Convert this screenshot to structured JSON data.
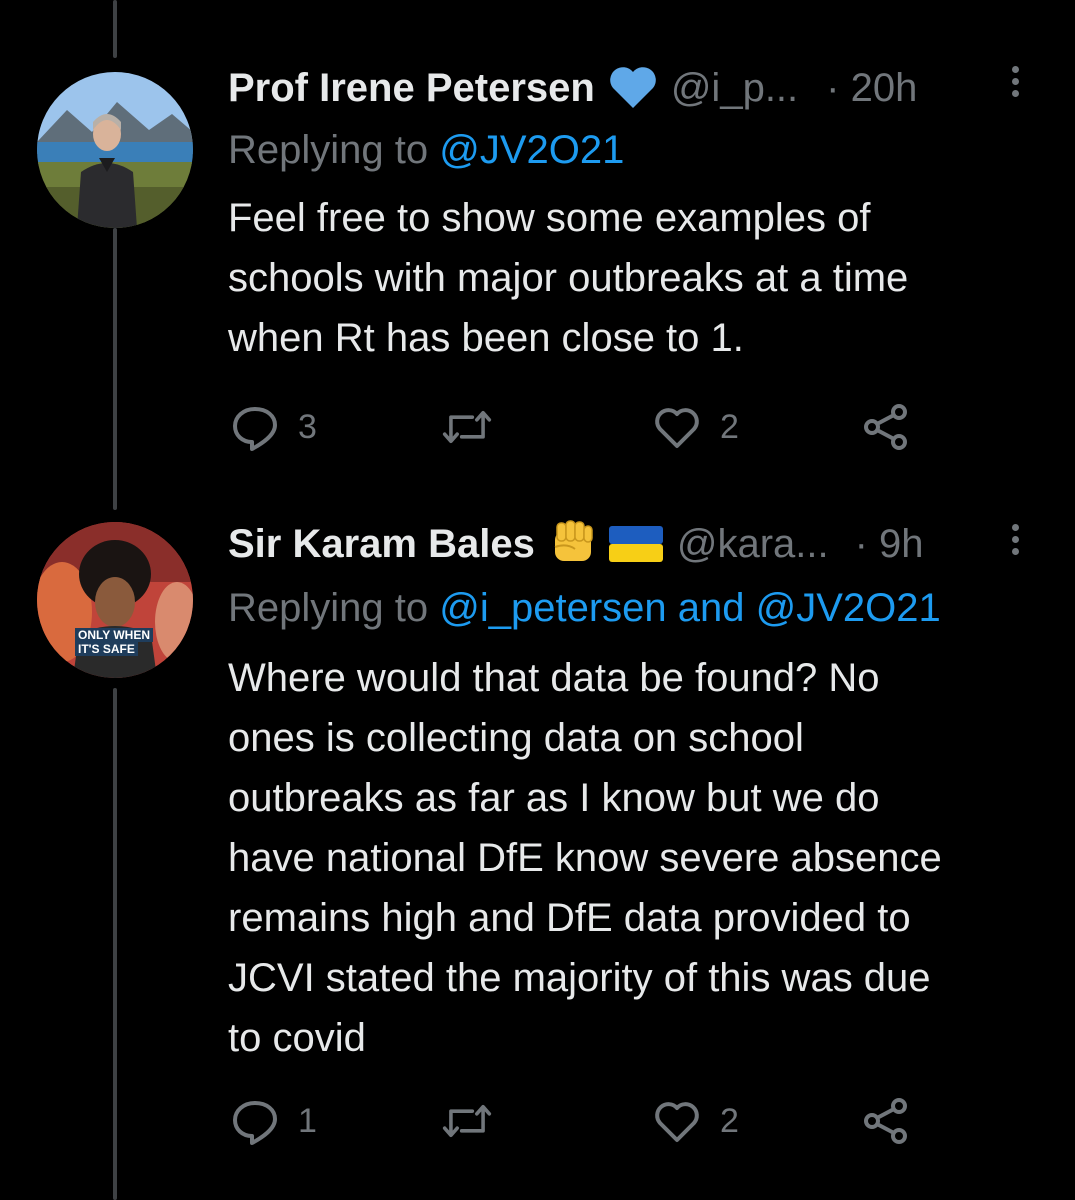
{
  "tweets": [
    {
      "name": "Prof Irene Petersen",
      "badge": "blue-heart",
      "handle": "@i_p...",
      "time": "· 20h",
      "replying_prefix": "Replying to ",
      "replying_mentions": "@JV2O21",
      "text": "Feel free to show some examples of\nschools with major outbreaks at a time\nwhen Rt has been close to 1.",
      "reply_count": "3",
      "like_count": "2"
    },
    {
      "name": "Sir Karam Bales",
      "badge": "raised-fist-and-ukraine-flag",
      "handle": "@kara...",
      "time": "· 9h",
      "replying_prefix": "Replying to ",
      "replying_mentions": "@i_petersen and @JV2O21",
      "text": "Where would that data be found? No\nones is collecting data on school\noutbreaks as far as I know but we do\nhave national DfE know severe absence\nremains high and DfE data provided to\nJCVI stated the majority of this was due\nto covid",
      "avatar_caption_1": "ONLY WHEN",
      "avatar_caption_2": "IT'S SAFE",
      "reply_count": "1",
      "like_count": "2"
    }
  ],
  "colors": {
    "accent": "#1d9bf0",
    "muted": "#71767b",
    "text": "#e7e9ea",
    "background": "#000000"
  },
  "icons": [
    "reply-icon",
    "retweet-icon",
    "like-icon",
    "share-icon",
    "more-icon",
    "heart-emoji",
    "raised-fist-emoji",
    "ukraine-flag"
  ]
}
